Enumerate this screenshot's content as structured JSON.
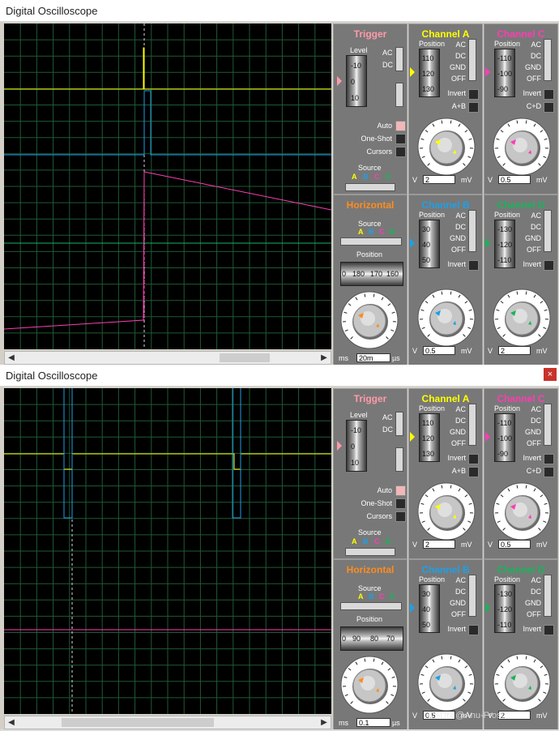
{
  "windows": [
    {
      "title": "Digital Oscilloscope",
      "show_close": false,
      "trigger": {
        "title": "Trigger",
        "level_label": "Level",
        "level_ticks": [
          "-10",
          "0",
          "10"
        ],
        "ac": "AC",
        "dc": "DC",
        "auto": "Auto",
        "oneshot": "One-Shot",
        "cursors": "Cursors",
        "source": "Source",
        "src": [
          "A",
          "B",
          "C",
          "D"
        ]
      },
      "horizontal": {
        "title": "Horizontal",
        "source": "Source",
        "src": [
          "A",
          "B",
          "C",
          "D"
        ],
        "position": "Position",
        "drum": [
          "0",
          "180",
          "170",
          "160"
        ],
        "value": "20m",
        "unit_left": "ms",
        "unit_right": "µs",
        "dial": [
          "0.5",
          "0.2",
          "0.1",
          "0.50",
          "1",
          "2",
          "5",
          "10",
          "20",
          "50",
          "100",
          "200",
          "0.5",
          "1",
          "2",
          "5",
          "10",
          "20",
          "50",
          "100"
        ]
      },
      "chA": {
        "title": "Channel A",
        "position": "Position",
        "drum": [
          "110",
          "120",
          "130"
        ],
        "modes": [
          "AC",
          "DC",
          "GND",
          "OFF"
        ],
        "invert": "Invert",
        "extra": "A+B",
        "value": "2",
        "unit_l": "V",
        "unit_r": "mV"
      },
      "chB": {
        "title": "Channel B",
        "position": "Position",
        "drum": [
          "30",
          "40",
          "50"
        ],
        "modes": [
          "AC",
          "DC",
          "GND",
          "OFF"
        ],
        "invert": "Invert",
        "value": "0.5",
        "unit_l": "V",
        "unit_r": "mV"
      },
      "chC": {
        "title": "Channel C",
        "position": "Position",
        "drum": [
          "-110",
          "-100",
          "-90"
        ],
        "modes": [
          "AC",
          "DC",
          "GND",
          "OFF"
        ],
        "invert": "Invert",
        "extra": "C+D",
        "value": "0.5",
        "unit_l": "V",
        "unit_r": "mV"
      },
      "chD": {
        "title": "Channel D",
        "position": "Position",
        "drum": [
          "-130",
          "-120",
          "-110"
        ],
        "modes": [
          "AC",
          "DC",
          "GND",
          "OFF"
        ],
        "invert": "Invert",
        "value": "2",
        "unit_l": "V",
        "unit_r": "mV"
      },
      "dial_v": [
        "0.5",
        "0.2",
        "0.1",
        "1",
        "50",
        "2",
        "20",
        "5",
        "10",
        "10",
        "5",
        "20",
        "2",
        "1"
      ]
    },
    {
      "title": "Digital Oscilloscope",
      "show_close": true,
      "trigger": {
        "title": "Trigger",
        "level_label": "Level",
        "level_ticks": [
          "-10",
          "0",
          "10"
        ],
        "ac": "AC",
        "dc": "DC",
        "auto": "Auto",
        "oneshot": "One-Shot",
        "cursors": "Cursors",
        "source": "Source",
        "src": [
          "A",
          "B",
          "C",
          "D"
        ]
      },
      "horizontal": {
        "title": "Horizontal",
        "source": "Source",
        "src": [
          "A",
          "B",
          "C",
          "D"
        ],
        "position": "Position",
        "drum": [
          "0",
          "90",
          "80",
          "70"
        ],
        "value": "0.1",
        "unit_left": "ms",
        "unit_right": "µs",
        "dial": [
          "0.5",
          "0.2",
          "0.1",
          "0.50",
          "1",
          "2",
          "5",
          "10",
          "20",
          "50",
          "100",
          "200",
          "0.5",
          "1",
          "2",
          "5",
          "10",
          "20",
          "50",
          "100"
        ]
      },
      "chA": {
        "title": "Channel A",
        "position": "Position",
        "drum": [
          "110",
          "120",
          "130"
        ],
        "modes": [
          "AC",
          "DC",
          "GND",
          "OFF"
        ],
        "invert": "Invert",
        "extra": "A+B",
        "value": "2",
        "unit_l": "V",
        "unit_r": "mV"
      },
      "chB": {
        "title": "Channel B",
        "position": "Position",
        "drum": [
          "30",
          "40",
          "50"
        ],
        "modes": [
          "AC",
          "DC",
          "GND",
          "OFF"
        ],
        "invert": "Invert",
        "value": "0.5",
        "unit_l": "V",
        "unit_r": "mV"
      },
      "chC": {
        "title": "Channel C",
        "position": "Position",
        "drum": [
          "-110",
          "-100",
          "-90"
        ],
        "modes": [
          "AC",
          "DC",
          "GND",
          "OFF"
        ],
        "invert": "Invert",
        "extra": "C+D",
        "value": "0.5",
        "unit_l": "V",
        "unit_r": "mV"
      },
      "chD": {
        "title": "Channel D",
        "position": "Position",
        "drum": [
          "-130",
          "-120",
          "-110"
        ],
        "modes": [
          "AC",
          "DC",
          "GND",
          "OFF"
        ],
        "invert": "Invert",
        "value": "2",
        "unit_l": "V",
        "unit_r": "mV"
      },
      "dial_v": [
        "0.5",
        "0.2",
        "0.1",
        "1",
        "50",
        "2",
        "20",
        "5",
        "10",
        "10",
        "5",
        "20",
        "2",
        "1"
      ]
    }
  ],
  "watermark": "CSDN @Anu-Frost",
  "colors": {
    "A": "#ffff00",
    "B": "#1ea0e6",
    "C": "#ff3cb4",
    "D": "#19b45a",
    "H": "#ff8c1e",
    "trigTitle": "#ff9aa8"
  },
  "close_icon": "×"
}
